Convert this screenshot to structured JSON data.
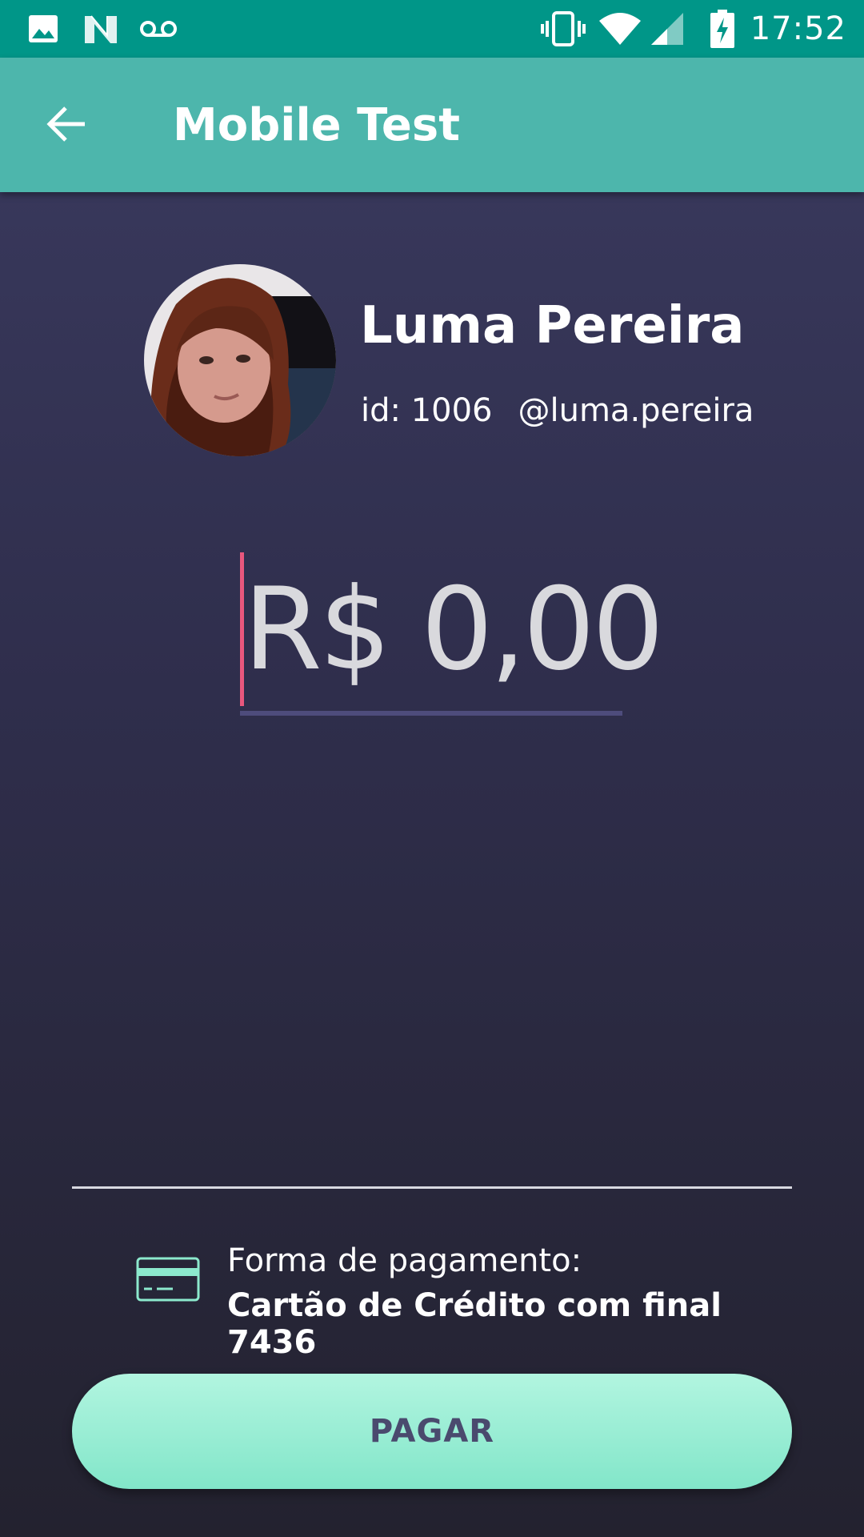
{
  "status_bar": {
    "time": "17:52",
    "left_icons": [
      "image-icon",
      "n-logo-icon",
      "voicemail-icon"
    ],
    "right_icons": [
      "vibrate-icon",
      "wifi-icon",
      "signal-icon",
      "battery-charging-icon"
    ]
  },
  "app_bar": {
    "title": "Mobile Test",
    "back_icon": "arrow-left-icon"
  },
  "profile": {
    "name": "Luma Pereira",
    "id_text": "id: 1006",
    "username": "@luma.pereira"
  },
  "amount": {
    "value": "R$ 0,00"
  },
  "payment": {
    "label": "Forma de pagamento:",
    "method": "Cartão de Crédito com final 7436",
    "icon": "credit-card-icon"
  },
  "pay_button": {
    "label": "PAGAR"
  },
  "colors": {
    "status_bar": "#009688",
    "app_bar": "#4db6ac",
    "background_top": "#3b3b60",
    "background_bottom": "#23222f",
    "cursor": "#e8577d",
    "accent_mint": "#8ce9cd",
    "button_text": "#4a4a6e"
  }
}
